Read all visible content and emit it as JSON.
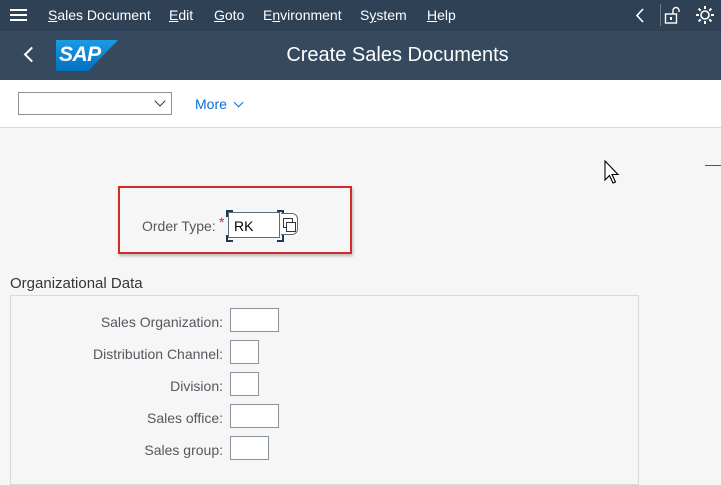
{
  "menubar": {
    "items": [
      {
        "label": "Sales Document",
        "mnemonic": "S"
      },
      {
        "label": "Edit",
        "mnemonic": "E"
      },
      {
        "label": "Goto",
        "mnemonic": "G"
      },
      {
        "label": "Environment",
        "mnemonic": "n"
      },
      {
        "label": "System",
        "mnemonic": "y"
      },
      {
        "label": "Help",
        "mnemonic": "H"
      }
    ],
    "right_icons": [
      "back-chevron-icon",
      "unlock-icon",
      "settings-icon"
    ]
  },
  "titlebar": {
    "logo_text": "SAP",
    "title": "Create Sales Documents"
  },
  "toolbar": {
    "dropdown_value": "",
    "more_label": "More"
  },
  "order_type": {
    "label": "Order Type:",
    "required_marker": "*",
    "value": "RK"
  },
  "org_data": {
    "title": "Organizational Data",
    "fields": [
      {
        "label": "Sales Organization:",
        "value": ""
      },
      {
        "label": "Distribution Channel:",
        "value": ""
      },
      {
        "label": "Division:",
        "value": ""
      },
      {
        "label": "Sales office:",
        "value": ""
      },
      {
        "label": "Sales group:",
        "value": ""
      }
    ]
  },
  "colors": {
    "menubar_bg": "#2f4155",
    "titlebar_bg": "#354a5f",
    "highlight": "#d12c2c",
    "link": "#0a6ed1"
  }
}
